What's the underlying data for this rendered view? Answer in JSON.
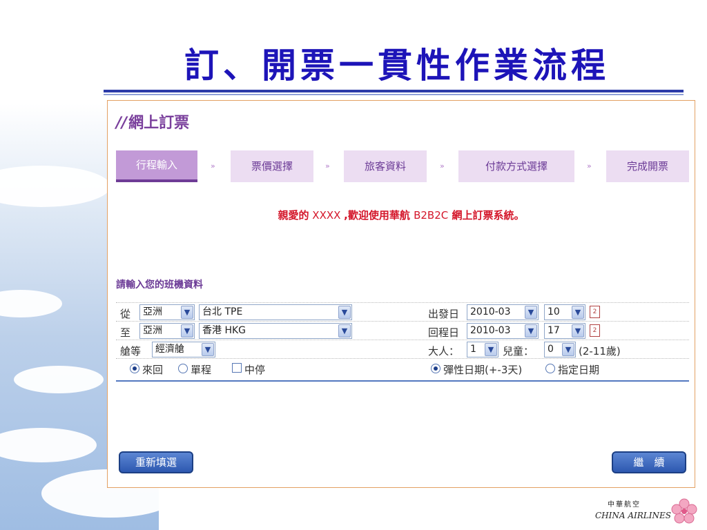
{
  "slide": {
    "title": "訂、開票一貫性作業流程"
  },
  "panel": {
    "slashes": "//",
    "heading": "網上訂票",
    "steps": [
      {
        "label": "行程輸入",
        "active": true
      },
      {
        "label": "票價選擇",
        "active": false
      },
      {
        "label": "旅客資料",
        "active": false
      },
      {
        "label": "付款方式選擇",
        "active": false
      },
      {
        "label": "完成開票",
        "active": false
      }
    ],
    "step_arrow": "»",
    "welcome": {
      "prefix": "親愛的",
      "name": " XXXX ",
      "middle": ",歡迎使用華航 ",
      "system_code": "B2B2C",
      "suffix": " 網上訂票系統。"
    },
    "section_label": "請輸入您的班機資料",
    "from_label": "從",
    "from_region": "亞洲",
    "from_city": "台北 TPE",
    "to_label": "至",
    "to_region": "亞洲",
    "to_city": "香港 HKG",
    "class_label": "艙等",
    "class_value": "經濟艙",
    "depart_label": "出發日",
    "depart_month": "2010-03",
    "depart_day": "10",
    "return_label": "回程日",
    "return_month": "2010-03",
    "return_day": "17",
    "adult_label": "大人：",
    "adult_value": "1",
    "child_label": "兒童：",
    "child_value": "0",
    "child_age_note": "(2-11歲)",
    "trip_round": "來回",
    "trip_oneway": "單程",
    "trip_stopover": "中停",
    "date_flexible": "彈性日期(+-3天)",
    "date_specific": "指定日期",
    "reset_button": "重新填選",
    "continue_button": "繼　續",
    "calendar_glyph": "2"
  },
  "logo": {
    "chinese": "中華航空",
    "english": "CHINA AIRLINES"
  },
  "colors": {
    "title": "#1d14b8",
    "accent_purple": "#6b3a96",
    "welcome_red": "#d4162a",
    "button_blue": "#2d58b0"
  }
}
